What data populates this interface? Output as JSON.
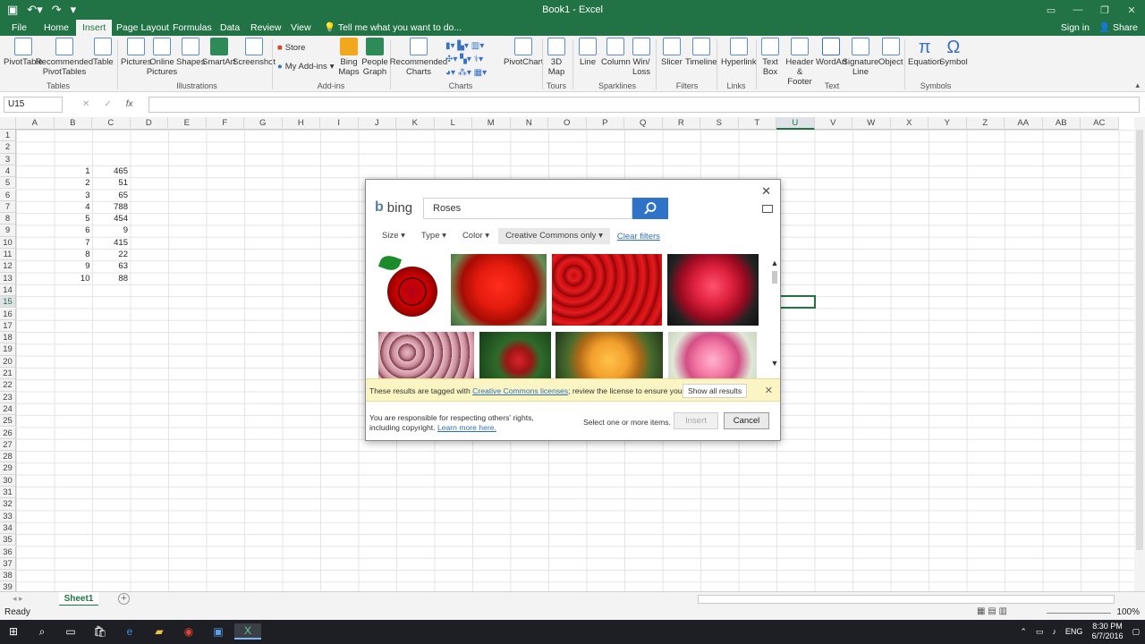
{
  "window": {
    "title": "Book1 - Excel"
  },
  "tabs": {
    "items": [
      "File",
      "Home",
      "Insert",
      "Page Layout",
      "Formulas",
      "Data",
      "Review",
      "View"
    ],
    "tell_me": "Tell me what you want to do...",
    "sign_in": "Sign in",
    "share": "Share"
  },
  "ribbon": {
    "buttons": [
      "PivotTable",
      "Recommended PivotTables",
      "Table",
      "Pictures",
      "Online Pictures",
      "Shapes",
      "SmartArt",
      "Screenshot",
      "Store",
      "My Add-ins",
      "Bing Maps",
      "People Graph",
      "Recommended Charts",
      "PivotChart",
      "3D Map",
      "Line",
      "Column",
      "Win/ Loss",
      "Slicer",
      "Timeline",
      "Hyperlink",
      "Text Box",
      "Header & Footer",
      "WordArt",
      "Signature Line",
      "Object",
      "Equation",
      "Symbol"
    ],
    "groups": [
      "Tables",
      "Illustrations",
      "Add-ins",
      "Charts",
      "Tours",
      "Sparklines",
      "Filters",
      "Links",
      "Text",
      "Symbols"
    ]
  },
  "formula_bar": {
    "name_box": "U15",
    "fx": "fx"
  },
  "columns": [
    "A",
    "B",
    "C",
    "D",
    "E",
    "F",
    "G",
    "H",
    "I",
    "J",
    "K",
    "L",
    "M",
    "N",
    "O",
    "P",
    "Q",
    "R",
    "S",
    "T",
    "U",
    "V",
    "W",
    "X",
    "Y",
    "Z",
    "AA",
    "AB",
    "AC"
  ],
  "rows": [
    "1",
    "2",
    "3",
    "4",
    "5",
    "6",
    "7",
    "8",
    "9",
    "10",
    "11",
    "12",
    "13",
    "14",
    "15",
    "16",
    "17",
    "18",
    "19",
    "20",
    "21",
    "22",
    "23",
    "24",
    "25",
    "26",
    "27",
    "28",
    "29",
    "30",
    "31",
    "32",
    "33",
    "34",
    "35",
    "36",
    "37",
    "38",
    "39"
  ],
  "cells": {
    "B": [
      "1",
      "2",
      "3",
      "4",
      "5",
      "6",
      "7",
      "8",
      "9",
      "10"
    ],
    "C": [
      "465",
      "51",
      "65",
      "788",
      "454",
      "9",
      "415",
      "22",
      "63",
      "88"
    ]
  },
  "sheet": {
    "name": "Sheet1"
  },
  "status": {
    "ready": "Ready",
    "zoom": "100%"
  },
  "taskbar": {
    "time": "8:30 PM",
    "date": "6/7/2016",
    "lang": "ENG"
  },
  "dialog": {
    "brand": "bing",
    "search_value": "Roses",
    "filters": [
      "Size",
      "Type",
      "Color",
      "Creative Commons only"
    ],
    "clear_filters": "Clear filters",
    "cc_notice_prefix": "These results are tagged with ",
    "cc_notice_link": "Creative Commons licenses",
    "cc_notice_suffix": "; review the license to ensure you comply.",
    "show_all": "Show all results",
    "footer_note": "You are responsible for respecting others' rights, including copyright. ",
    "learn_more": "Learn more here.",
    "select_msg": "Select one or more items.",
    "insert": "Insert",
    "cancel": "Cancel"
  },
  "colors": {
    "excel_green": "#217346",
    "bing_blue": "#2f73c8",
    "notice_yellow": "#fbf5c3"
  }
}
